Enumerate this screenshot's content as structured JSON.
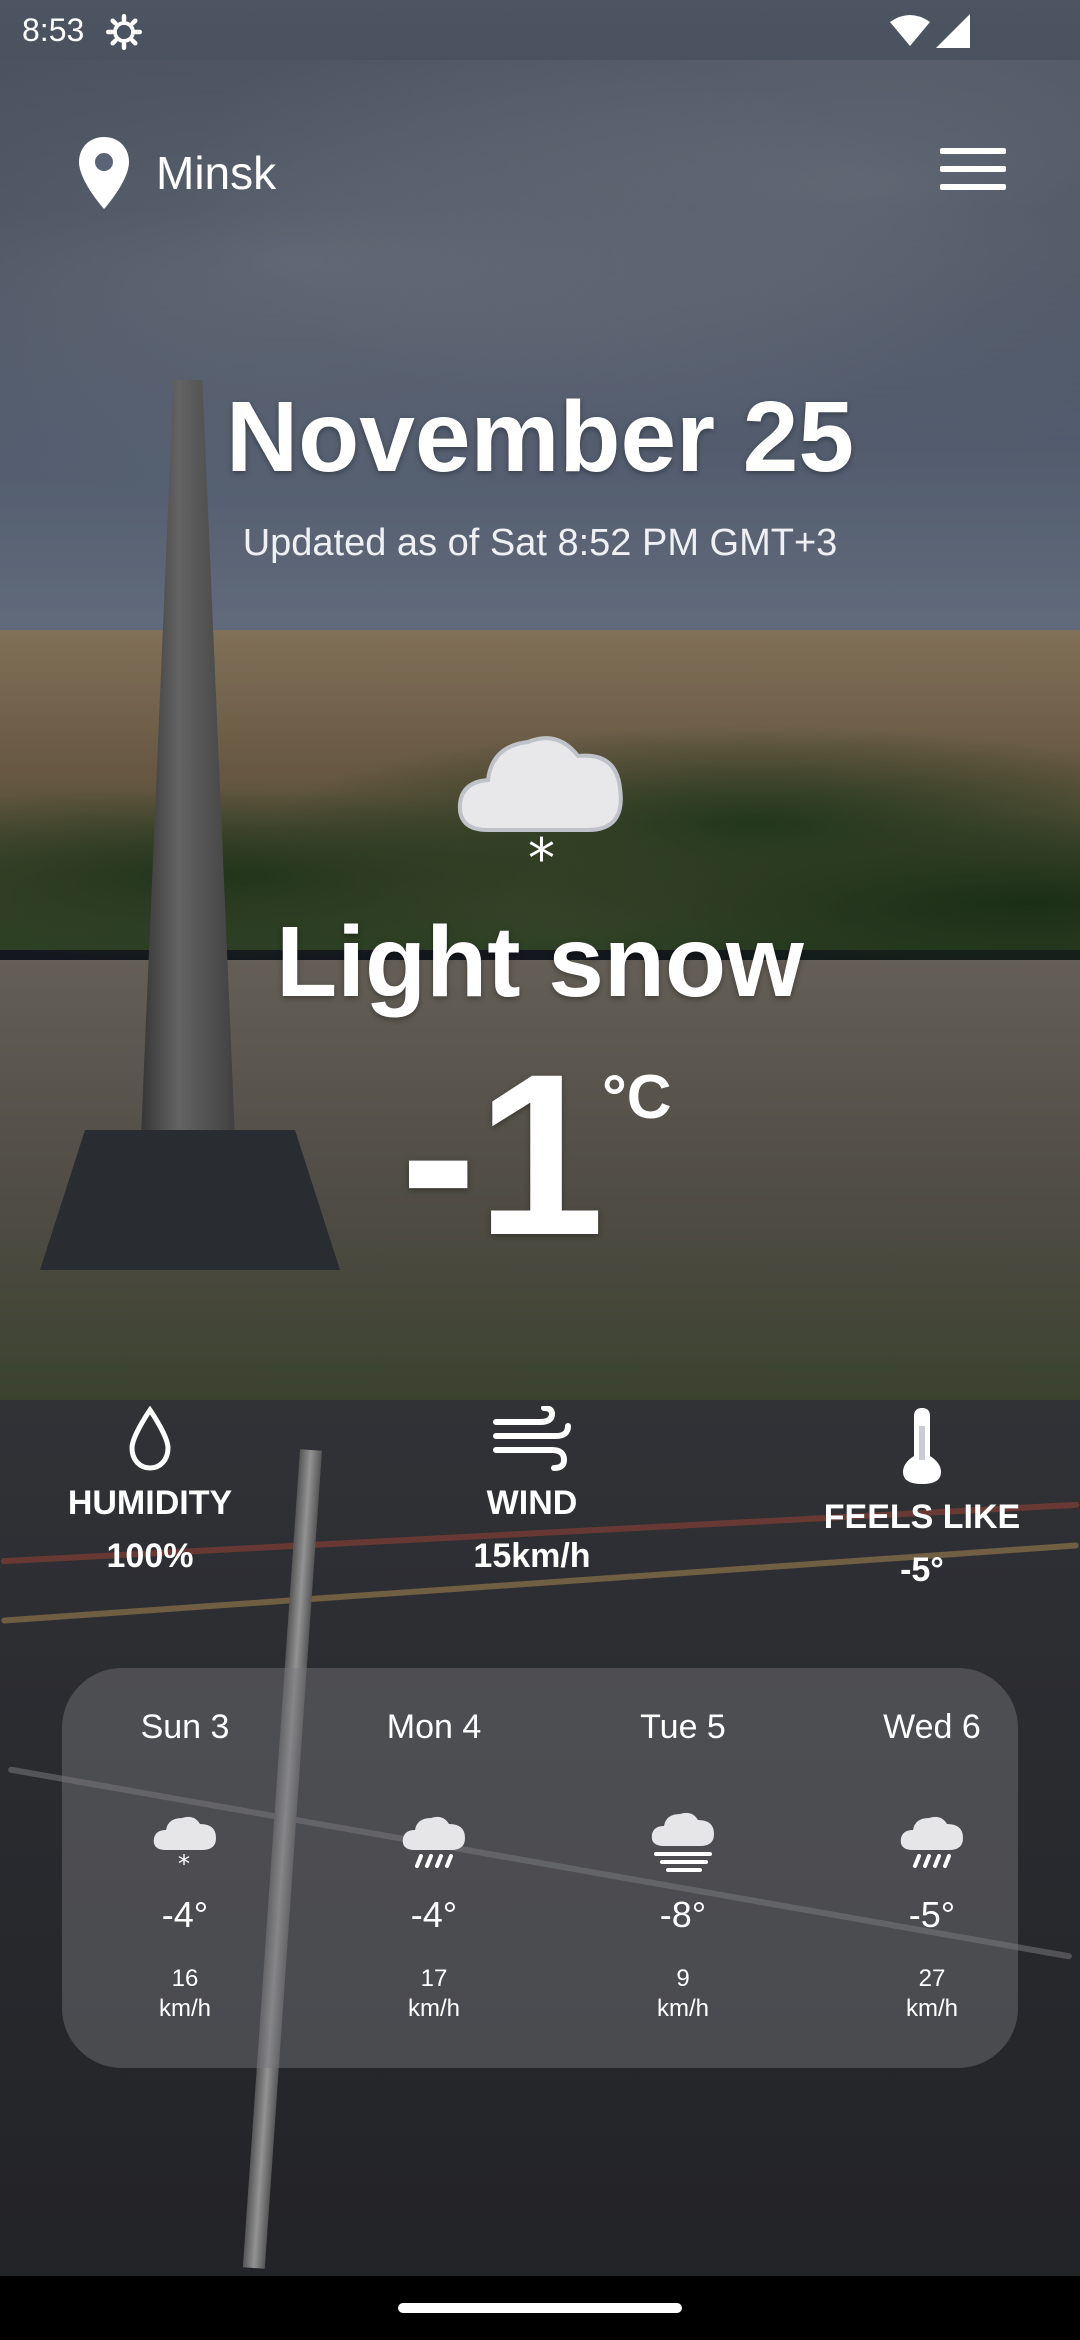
{
  "status_bar": {
    "time": "8:53"
  },
  "header": {
    "city": "Minsk"
  },
  "main": {
    "date": "November 25",
    "updated": "Updated as of Sat 8:52 PM GMT+3",
    "condition": "Light snow",
    "condition_icon": "cloud-snow-icon",
    "temperature": "-1",
    "unit": "°C"
  },
  "metrics": [
    {
      "label": "HUMIDITY",
      "value": "100%",
      "icon": "humidity-drop-icon"
    },
    {
      "label": "WIND",
      "value": "15km/h",
      "icon": "wind-icon"
    },
    {
      "label": "FEELS LIKE",
      "value": "-5°",
      "icon": "thermometer-icon"
    }
  ],
  "forecast": [
    {
      "day": "Sun 3",
      "temp": "-4°",
      "wind_value": "16",
      "wind_unit": "km/h",
      "icon": "cloud-snow-icon"
    },
    {
      "day": "Mon 4",
      "temp": "-4°",
      "wind_value": "17",
      "wind_unit": "km/h",
      "icon": "cloud-rain-icon"
    },
    {
      "day": "Tue 5",
      "temp": "-8°",
      "wind_value": "9",
      "wind_unit": "km/h",
      "icon": "cloud-fog-icon"
    },
    {
      "day": "Wed 6",
      "temp": "-5°",
      "wind_value": "27",
      "wind_unit": "km/h",
      "icon": "cloud-rain-icon"
    }
  ],
  "colors": {
    "text": "#ffffff",
    "card": "#78787d",
    "navbar": "#000000"
  }
}
